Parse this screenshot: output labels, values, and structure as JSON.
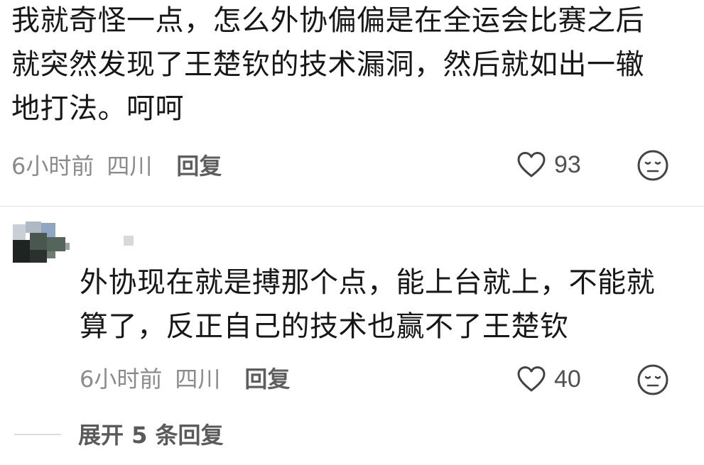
{
  "comments": [
    {
      "lines": [
        "我就奇怪一点，怎么外协偏偏是在全运会比赛之后",
        "就突然发现了王楚钦的技术漏洞，然后就如出一辙",
        "地打法。呵呵"
      ],
      "time": "6小时前",
      "location": "四川",
      "reply_label": "回复",
      "likes": "93"
    },
    {
      "lines": [
        "外协现在就是搏那个点，能上台就上，不能就",
        "算了，反正自己的技术也赢不了王楚钦"
      ],
      "time": "6小时前",
      "location": "四川",
      "reply_label": "回复",
      "likes": "40"
    }
  ],
  "expand_label": "展开 5 条回复",
  "icons": {
    "like": "heart-outline-icon",
    "dislike": "unhappy-face-icon"
  },
  "colors": {
    "text": "#171717",
    "meta": "#8b8b8b",
    "icon": "#444444"
  }
}
